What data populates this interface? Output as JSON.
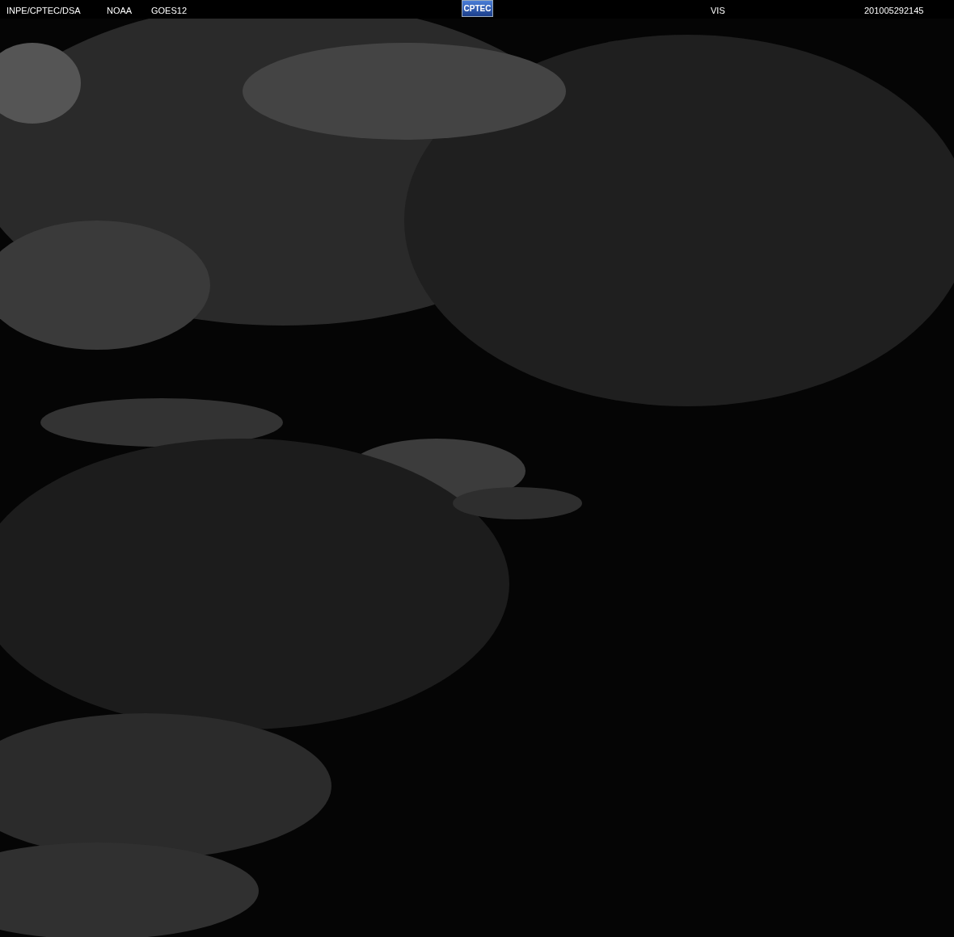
{
  "header": {
    "source": "INPE/CPTEC/DSA",
    "agency": "NOAA",
    "satellite": "GOES12",
    "logo": "CPTEC",
    "channel": "VIS",
    "timestamp": "201005292145"
  }
}
